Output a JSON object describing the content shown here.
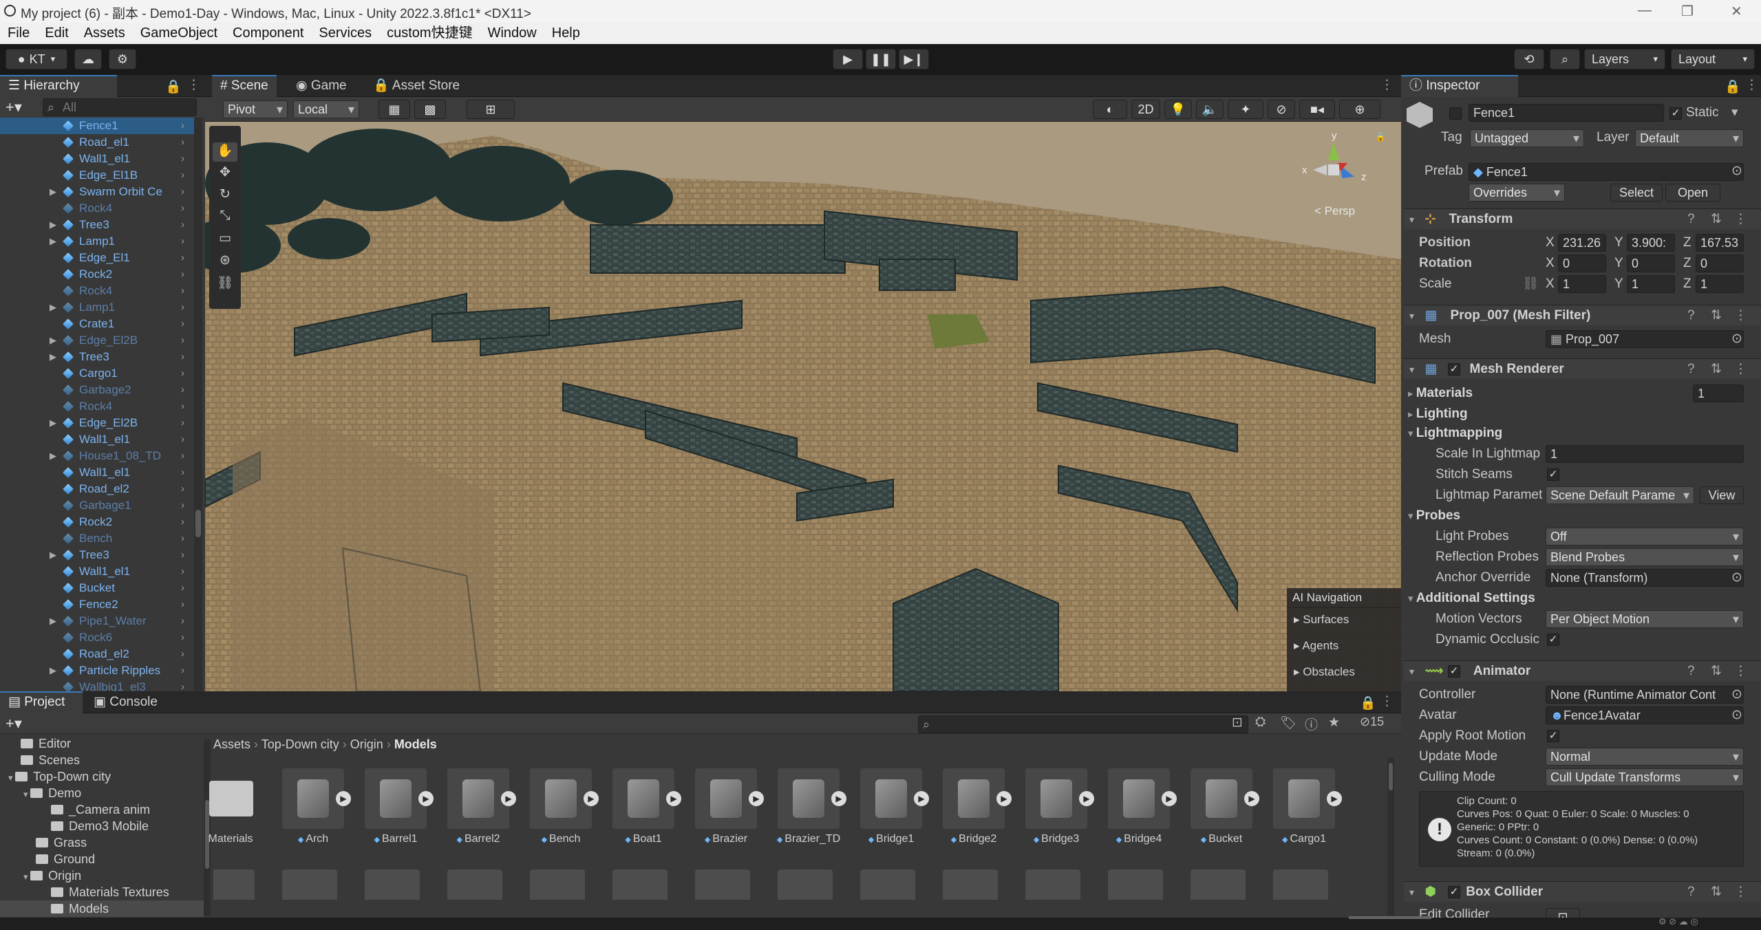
{
  "window": {
    "title": "My project (6) - 副本 - Demo1-Day - Windows, Mac, Linux - Unity 2022.3.8f1c1* <DX11>"
  },
  "menu": [
    "File",
    "Edit",
    "Assets",
    "GameObject",
    "Component",
    "Services",
    "custom快捷键",
    "Window",
    "Help"
  ],
  "toolbar": {
    "account": "KT",
    "layers": "Layers",
    "layout": "Layout"
  },
  "hierarchy": {
    "tab": "Hierarchy",
    "search_placeholder": "All",
    "items": [
      {
        "label": "Fence1",
        "style": "pref",
        "fold": false,
        "selected": true
      },
      {
        "label": "Road_el1",
        "style": "pref",
        "fold": false
      },
      {
        "label": "Wall1_el1",
        "style": "pref",
        "fold": false
      },
      {
        "label": "Edge_El1B",
        "style": "pref",
        "fold": false
      },
      {
        "label": "Swarm Orbit Ce",
        "style": "pref",
        "fold": true
      },
      {
        "label": "Rock4",
        "style": "dim",
        "fold": false
      },
      {
        "label": "Tree3",
        "style": "pref",
        "fold": true
      },
      {
        "label": "Lamp1",
        "style": "pref",
        "fold": true
      },
      {
        "label": "Edge_El1",
        "style": "pref",
        "fold": false
      },
      {
        "label": "Rock2",
        "style": "pref",
        "fold": false
      },
      {
        "label": "Rock4",
        "style": "dim",
        "fold": false
      },
      {
        "label": "Lamp1",
        "style": "dim",
        "fold": true
      },
      {
        "label": "Crate1",
        "style": "pref",
        "fold": false
      },
      {
        "label": "Edge_El2B",
        "style": "dim",
        "fold": true
      },
      {
        "label": "Tree3",
        "style": "pref",
        "fold": true
      },
      {
        "label": "Cargo1",
        "style": "pref",
        "fold": false
      },
      {
        "label": "Garbage2",
        "style": "dim",
        "fold": false
      },
      {
        "label": "Rock4",
        "style": "dim",
        "fold": false
      },
      {
        "label": "Edge_El2B",
        "style": "pref",
        "fold": true
      },
      {
        "label": "Wall1_el1",
        "style": "pref",
        "fold": false
      },
      {
        "label": "House1_08_TD",
        "style": "dim",
        "fold": true
      },
      {
        "label": "Wall1_el1",
        "style": "pref",
        "fold": false
      },
      {
        "label": "Road_el2",
        "style": "pref",
        "fold": false
      },
      {
        "label": "Garbage1",
        "style": "dim",
        "fold": false
      },
      {
        "label": "Rock2",
        "style": "pref",
        "fold": false
      },
      {
        "label": "Bench",
        "style": "dim",
        "fold": false
      },
      {
        "label": "Tree3",
        "style": "pref",
        "fold": true
      },
      {
        "label": "Wall1_el1",
        "style": "pref",
        "fold": false
      },
      {
        "label": "Bucket",
        "style": "pref",
        "fold": false
      },
      {
        "label": "Fence2",
        "style": "pref",
        "fold": false
      },
      {
        "label": "Pipe1_Water",
        "style": "dim",
        "fold": true
      },
      {
        "label": "Rock6",
        "style": "dim",
        "fold": false
      },
      {
        "label": "Road_el2",
        "style": "pref",
        "fold": false
      },
      {
        "label": "Particle Ripples",
        "style": "pref",
        "fold": true
      },
      {
        "label": "Wallbig1_el3",
        "style": "dim",
        "fold": false
      }
    ]
  },
  "scene": {
    "tabs": [
      "Scene",
      "Game",
      "Asset Store"
    ],
    "pivot": "Pivot",
    "local": "Local",
    "mode_2d": "2D",
    "persp": "< Persp",
    "gizmo_axes": {
      "x": "x",
      "y": "y",
      "z": "z"
    },
    "ai_nav": {
      "title": "AI Navigation",
      "items": [
        "Surfaces",
        "Agents",
        "Obstacles"
      ]
    }
  },
  "inspector": {
    "tab": "Inspector",
    "name": "Fence1",
    "static_label": "Static",
    "tag_label": "Tag",
    "tag": "Untagged",
    "layer_label": "Layer",
    "layer": "Default",
    "prefab_label": "Prefab",
    "prefab": "Fence1",
    "overrides": "Overrides",
    "select": "Select",
    "open": "Open",
    "transform": {
      "title": "Transform",
      "position_label": "Position",
      "position": {
        "x": "231.26",
        "y": "3.900:",
        "z": "167.53"
      },
      "rotation_label": "Rotation",
      "rotation": {
        "x": "0",
        "y": "0",
        "z": "0"
      },
      "scale_label": "Scale",
      "scale": {
        "x": "1",
        "y": "1",
        "z": "1"
      }
    },
    "mesh_filter": {
      "title": "Prop_007 (Mesh Filter)",
      "mesh_label": "Mesh",
      "mesh": "Prop_007"
    },
    "mesh_renderer": {
      "title": "Mesh Renderer",
      "materials_label": "Materials",
      "materials_count": "1",
      "lighting_label": "Lighting",
      "lightmapping_label": "Lightmapping",
      "scale_lightmap_label": "Scale In Lightmap",
      "scale_lightmap": "1",
      "stitch_label": "Stitch Seams",
      "lightmap_param_label": "Lightmap Paramet",
      "lightmap_param": "Scene Default Parame",
      "view": "View",
      "probes_label": "Probes",
      "light_probes_label": "Light Probes",
      "light_probes": "Off",
      "reflection_label": "Reflection Probes",
      "reflection": "Blend Probes",
      "anchor_label": "Anchor Override",
      "anchor": "None (Transform)",
      "additional_label": "Additional Settings",
      "motion_label": "Motion Vectors",
      "motion": "Per Object Motion",
      "dynamic_label": "Dynamic Occlusic"
    },
    "animator": {
      "title": "Animator",
      "controller_label": "Controller",
      "controller": "None (Runtime Animator Cont",
      "avatar_label": "Avatar",
      "avatar": "Fence1Avatar",
      "root_motion_label": "Apply Root Motion",
      "update_label": "Update Mode",
      "update": "Normal",
      "culling_label": "Culling Mode",
      "culling": "Cull Update Transforms",
      "info": [
        "Clip Count: 0",
        "Curves Pos: 0 Quat: 0 Euler: 0 Scale: 0 Muscles: 0",
        "Generic: 0 PPtr: 0",
        "Curves Count: 0 Constant: 0 (0.0%) Dense: 0 (0.0%)",
        "Stream: 0 (0.0%)"
      ]
    },
    "box_collider": {
      "title": "Box Collider",
      "edit_label": "Edit Collider"
    }
  },
  "project": {
    "tabs": [
      "Project",
      "Console"
    ],
    "hidden_count": "15",
    "tree": [
      {
        "label": "Editor",
        "indent": 0
      },
      {
        "label": "Scenes",
        "indent": 0
      },
      {
        "label": "Top-Down city",
        "indent": 0,
        "open": true
      },
      {
        "label": "Demo",
        "indent": 1,
        "open": true
      },
      {
        "label": "_Camera anim",
        "indent": 2
      },
      {
        "label": "Demo3 Mobile",
        "indent": 2
      },
      {
        "label": "Grass",
        "indent": 1
      },
      {
        "label": "Ground",
        "indent": 1
      },
      {
        "label": "Origin",
        "indent": 1,
        "open": true
      },
      {
        "label": "Materials Textures",
        "indent": 2
      },
      {
        "label": "Models",
        "indent": 2,
        "selected": true
      }
    ],
    "breadcrumb": [
      "Assets",
      "Top-Down city",
      "Origin",
      "Models"
    ],
    "assets": [
      "Materials",
      "Arch",
      "Barrel1",
      "Barrel2",
      "Bench",
      "Boat1",
      "Brazier",
      "Brazier_TD",
      "Bridge1",
      "Bridge2",
      "Bridge3",
      "Bridge4",
      "Bucket",
      "Cargo1"
    ]
  },
  "colors": {
    "accent": "#3a79bb",
    "selection": "#2c5d87",
    "prefab_text": "#7cb3ee"
  }
}
